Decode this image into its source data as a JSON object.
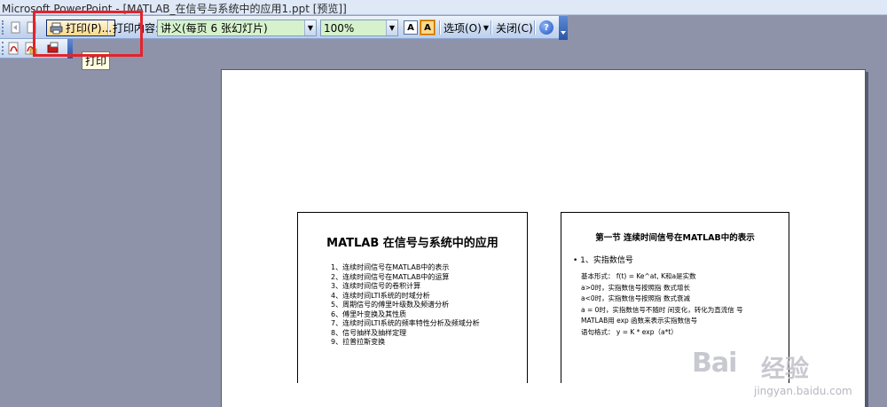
{
  "window": {
    "title": "Microsoft PowerPoint - [MATLAB_在信号与系统中的应用1.ppt [预览]]"
  },
  "toolbar": {
    "print_label": "打印(P)...",
    "print_what_label": "打印内容:",
    "print_what_value": "讲义(每页 6 张幻灯片)",
    "zoom_value": "100%",
    "options_label": "选项(O)",
    "close_label": "关闭(C)",
    "help_glyph": "?",
    "landscape_glyph": "A",
    "portrait_glyph": "A"
  },
  "tooltip": {
    "text": "打印"
  },
  "slides": [
    {
      "title": "MATLAB 在信号与系统中的应用",
      "items": [
        "1、连续时间信号在MATLAB中的表示",
        "2、连续时间信号在MATLAB中的运算",
        "3、连续时间信号的卷积计算",
        "4、连续时间LTI系统的时域分析",
        "5、周期信号的傅里叶级数及频谱分析",
        "6、傅里叶变换及其性质",
        "7、连续时间LTI系统的频率特性分析及频域分析",
        "8、信号抽样及抽样定理",
        "9、拉普拉斯变换"
      ]
    },
    {
      "title": "第一节  连续时间信号在MATLAB中的表示",
      "bullet": "•  1、实指数信号",
      "lines": [
        "基本形式： f(t) = Ke^at, K和a是实数",
        "a>0时，实指数信号按照指  数式增长",
        "a<0时，实指数信号按照指  数式衰减",
        "a = 0时，实指数信号不随时  间变化，转化为直流信  号",
        "MATLAB用 exp 函数来表示实指数信号",
        "语句格式： y = K * exp（a*t）"
      ]
    }
  ],
  "watermark": {
    "logo": "Bai",
    "text": "经验",
    "url": "jingyan.baidu.com"
  },
  "colors": {
    "highlight": "#e3232c",
    "background": "#8e93aa",
    "combo": "#d6f2cc"
  }
}
